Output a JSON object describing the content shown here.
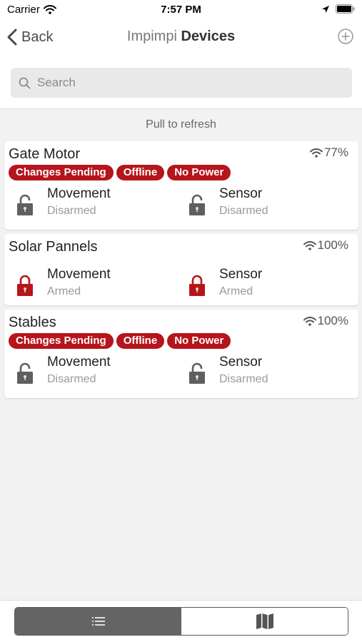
{
  "status_bar": {
    "carrier": "Carrier",
    "time": "7:57 PM"
  },
  "nav": {
    "back_label": "Back",
    "title_light": "Impimpi",
    "title_bold": "Devices"
  },
  "search": {
    "placeholder": "Search"
  },
  "pull_to_refresh": "Pull to refresh",
  "devices": [
    {
      "name": "Gate Motor",
      "signal": "77%",
      "badges": [
        "Changes Pending",
        "Offline",
        "No Power"
      ],
      "zones": [
        {
          "label": "Movement",
          "state": "Disarmed",
          "armed": false
        },
        {
          "label": "Sensor",
          "state": "Disarmed",
          "armed": false
        }
      ]
    },
    {
      "name": "Solar Pannels",
      "signal": "100%",
      "badges": [],
      "zones": [
        {
          "label": "Movement",
          "state": "Armed",
          "armed": true
        },
        {
          "label": "Sensor",
          "state": "Armed",
          "armed": true
        }
      ]
    },
    {
      "name": "Stables",
      "signal": "100%",
      "badges": [
        "Changes Pending",
        "Offline",
        "No Power"
      ],
      "zones": [
        {
          "label": "Movement",
          "state": "Disarmed",
          "armed": false
        },
        {
          "label": "Sensor",
          "state": "Disarmed",
          "armed": false
        }
      ]
    }
  ],
  "tabs": [
    {
      "icon": "list-icon",
      "active": true
    },
    {
      "icon": "map-icon",
      "active": false
    }
  ],
  "colors": {
    "badge": "#b5151b",
    "armed_lock": "#b5151b",
    "disarmed_lock": "#5f5f5f",
    "active_tab": "#646464"
  }
}
